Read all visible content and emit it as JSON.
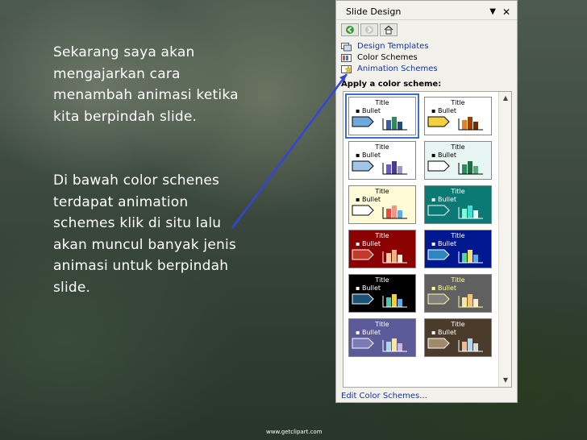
{
  "caption": {
    "paragraph1": "Sekarang saya akan mengajarkan cara menambah animasi ketika kita berpindah slide.",
    "paragraph2": "Di bawah color schenes terdapat animation schemes klik di situ lalu akan muncul banyak jenis animasi untuk berpindah slide."
  },
  "task_pane": {
    "title": "Slide Design",
    "links": [
      "Design Templates",
      "Color Schemes",
      "Animation Schemes"
    ],
    "section_label": "Apply a color scheme:",
    "thumbnail_title": "Title",
    "thumbnail_bullet": "Bullet",
    "footer_link": "Edit Color Schemes...",
    "nav_icons": [
      "back-icon",
      "forward-icon",
      "home-icon"
    ]
  },
  "color_schemes": [
    {
      "bg": "#ffffff",
      "text": "#000000",
      "arrow": "#6fa8dc",
      "bars": [
        "#3c5aa6",
        "#2e8b57",
        "#1f4e79"
      ],
      "selected": true
    },
    {
      "bg": "#ffffff",
      "text": "#000000",
      "arrow": "#f4d03f",
      "bars": [
        "#e67e22",
        "#a04000",
        "#6e2c00"
      ],
      "selected": false
    },
    {
      "bg": "#ffffff",
      "text": "#000000",
      "arrow": "#9fc5e8",
      "bars": [
        "#6a5acd",
        "#483d8b",
        "#9a9ad0"
      ],
      "selected": false
    },
    {
      "bg": "#e8f6f3",
      "text": "#000000",
      "arrow": "#ffffff",
      "bars": [
        "#2e8b57",
        "#1e6f44",
        "#55aa77"
      ],
      "selected": false
    },
    {
      "bg": "#fffbd6",
      "text": "#000000",
      "arrow": "#ffffff",
      "bars": [
        "#e74c3c",
        "#f1948a",
        "#5dade2"
      ],
      "selected": false
    },
    {
      "bg": "#0b7a75",
      "text": "#ffffff",
      "arrow": "#0b7a75",
      "bars": [
        "#7fffd4",
        "#40e0d0",
        "#e0ffff"
      ],
      "selected": false
    },
    {
      "bg": "#8b0000",
      "text": "#ffffff",
      "arrow": "#c0392b",
      "bars": [
        "#f5cba7",
        "#f0b27a",
        "#fdebd0"
      ],
      "selected": false
    },
    {
      "bg": "#00188f",
      "text": "#ffffff",
      "arrow": "#2e86c1",
      "bars": [
        "#58d68d",
        "#f7dc6f",
        "#5dade2"
      ],
      "selected": false
    },
    {
      "bg": "#000000",
      "text": "#ffffff",
      "arrow": "#1a5276",
      "bars": [
        "#48c9b0",
        "#f4d03f",
        "#5dade2"
      ],
      "selected": false
    },
    {
      "bg": "#606060",
      "text": "#ffff99",
      "arrow": "#808080",
      "bars": [
        "#f9e79f",
        "#f8c471",
        "#fdebd0"
      ],
      "selected": false
    },
    {
      "bg": "#5b5b9a",
      "text": "#ffffff",
      "arrow": "#7a7ab8",
      "bars": [
        "#aed6f1",
        "#f9e79f",
        "#d2b4de"
      ],
      "selected": false
    },
    {
      "bg": "#4b3b2b",
      "text": "#ffffff",
      "arrow": "#a08a6a",
      "bars": [
        "#edbb99",
        "#aed6f1",
        "#d5dbdb"
      ],
      "selected": false
    }
  ],
  "watermark": "www.getclipart.com"
}
